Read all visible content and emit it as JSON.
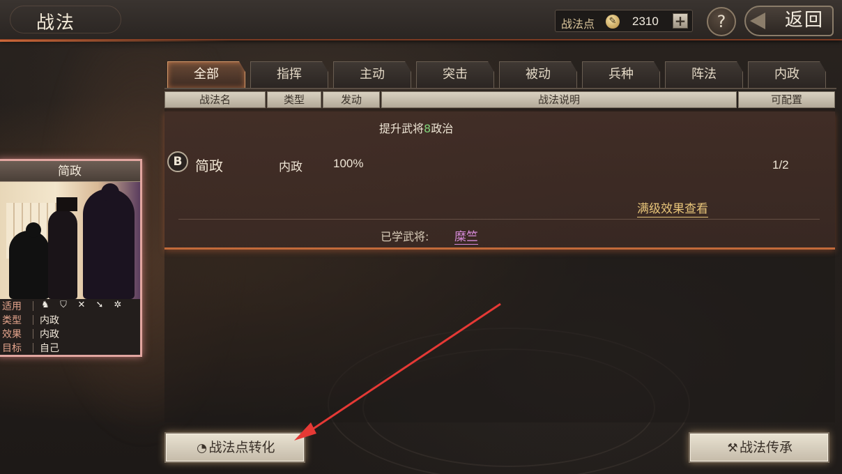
{
  "header": {
    "title": "战法",
    "points_label": "战法点",
    "points_value": "2310",
    "points_add": "+",
    "help": "?",
    "back": "返回"
  },
  "tabs": [
    {
      "label": "全部",
      "active": true
    },
    {
      "label": "指挥",
      "active": false
    },
    {
      "label": "主动",
      "active": false
    },
    {
      "label": "突击",
      "active": false
    },
    {
      "label": "被动",
      "active": false
    },
    {
      "label": "兵种",
      "active": false
    },
    {
      "label": "阵法",
      "active": false
    },
    {
      "label": "内政",
      "active": false
    }
  ],
  "columns": [
    "战法名",
    "类型",
    "发动",
    "战法说明",
    "可配置"
  ],
  "skill": {
    "grade": "B",
    "name": "简政",
    "type": "内政",
    "activation": "100%",
    "desc_prefix": "提升武将",
    "desc_number": "8",
    "desc_suffix": "政治",
    "slots": "1/2",
    "max_effect_link": "满级效果查看",
    "learned_label": "已学武将:",
    "learned_general": "糜竺"
  },
  "card": {
    "title": "简政",
    "rows": [
      {
        "key": "适用",
        "value": ""
      },
      {
        "key": "类型",
        "value": "内政"
      },
      {
        "key": "效果",
        "value": "内政"
      },
      {
        "key": "目标",
        "value": "自己"
      }
    ],
    "troop_icons": [
      "cavalry-icon",
      "shield-icon",
      "bow-icon",
      "spear-icon",
      "wheel-icon"
    ]
  },
  "buttons": {
    "convert": "战法点转化",
    "inherit": "战法传承"
  },
  "colors": {
    "active_tab_border": "#d79a6a",
    "highlight_number": "#7fd37a",
    "link_gold": "#e8c57a",
    "general_purple": "#d68ad8",
    "annotation_arrow": "#e53935"
  }
}
